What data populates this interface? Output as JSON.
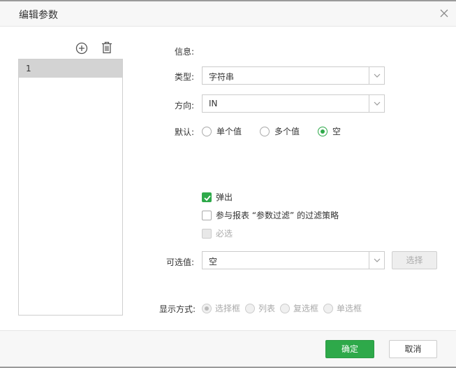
{
  "dialog": {
    "title": "编辑参数",
    "close_icon": "close-icon"
  },
  "param_list": {
    "add_icon": "plus-circle-icon",
    "delete_icon": "trash-icon",
    "items": [
      "1"
    ]
  },
  "form": {
    "info_label": "信息:",
    "type_label": "类型:",
    "type_value": "字符串",
    "direction_label": "方向:",
    "direction_value": "IN",
    "default_label": "默认:",
    "default_options": [
      {
        "label": "单个值",
        "checked": false
      },
      {
        "label": "多个值",
        "checked": false
      },
      {
        "label": "空",
        "checked": true
      }
    ],
    "popup_label": "弹出",
    "popup_checked": true,
    "report_filter_label": "参与报表 “参数过滤” 的过滤策略",
    "report_filter_checked": false,
    "required_label": "必选",
    "required_checked": false,
    "optional_values_label": "可选值:",
    "optional_values_value": "空",
    "select_button": "选择",
    "display_label": "显示方式:",
    "display_options": [
      {
        "label": "选择框",
        "checked": true
      },
      {
        "label": "列表",
        "checked": false
      },
      {
        "label": "复选框",
        "checked": false
      },
      {
        "label": "单选框",
        "checked": false
      }
    ]
  },
  "footer": {
    "ok_label": "确定",
    "cancel_label": "取消"
  },
  "colors": {
    "accent": "#2ea94a",
    "header_bg": "#f7f7f7",
    "selected_item": "#d3d3d3"
  }
}
